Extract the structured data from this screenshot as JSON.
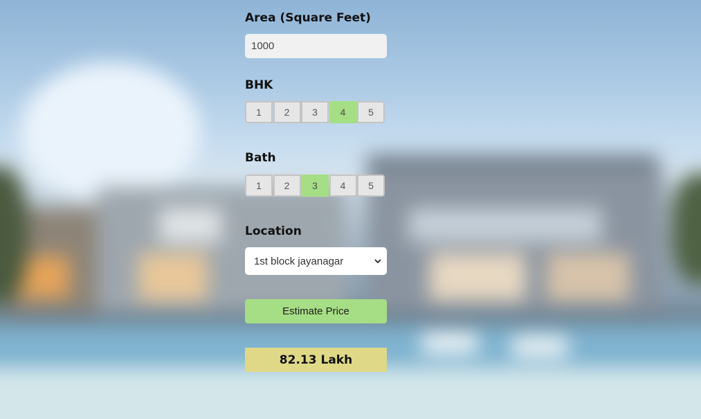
{
  "colors": {
    "selected_option": "#a6de85",
    "result_background": "#dfd887",
    "button_background": "#a6de85"
  },
  "form": {
    "area": {
      "label": "Area (Square Feet)",
      "value": "1000"
    },
    "bhk": {
      "label": "BHK",
      "options": [
        "1",
        "2",
        "3",
        "4",
        "5"
      ],
      "selected": "4"
    },
    "bath": {
      "label": "Bath",
      "options": [
        "1",
        "2",
        "3",
        "4",
        "5"
      ],
      "selected": "3"
    },
    "location": {
      "label": "Location",
      "selected": "1st block jayanagar"
    },
    "estimate_button": "Estimate Price",
    "result": "82.13 Lakh"
  }
}
